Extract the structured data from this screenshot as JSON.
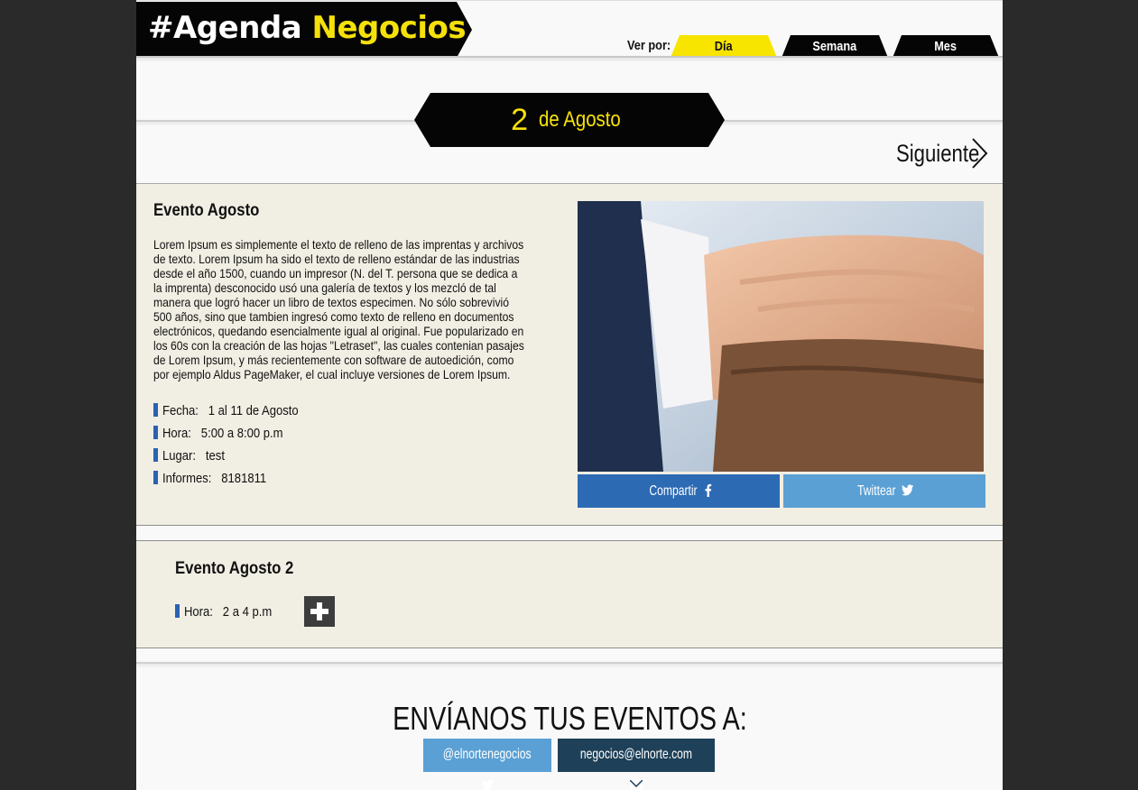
{
  "header": {
    "logo_prefix": "#Agenda ",
    "logo_highlight": "Negocios",
    "view_label": "Ver por:",
    "tabs": [
      {
        "label": "Día",
        "active": true
      },
      {
        "label": "Semana",
        "active": false
      },
      {
        "label": "Mes",
        "active": false
      }
    ]
  },
  "date": {
    "day": "2",
    "month": "de Agosto",
    "next_label": "Siguiente"
  },
  "events": [
    {
      "title": "Evento Agosto",
      "description": "Lorem Ipsum es simplemente el texto de relleno de las imprentas y archivos de texto. Lorem Ipsum ha sido el texto de relleno estándar de las industrias desde el año 1500, cuando un impresor (N. del T. persona que se dedica a la imprenta) desconocido usó una galería de textos y los mezcló de tal manera que logró hacer un libro de textos especimen. No sólo sobrevivió 500 años, sino que tambien ingresó como texto de relleno en documentos electrónicos, quedando esencialmente igual al original. Fue popularizado en los 60s con la creación de las hojas \"Letraset\", las cuales contenian pasajes de Lorem Ipsum, y más recientemente con software de autoedición, como por ejemplo Aldus PageMaker, el cual incluye versiones de Lorem Ipsum.",
      "details": [
        {
          "label": "Fecha:",
          "value": "1 al 11 de Agosto"
        },
        {
          "label": "Hora:",
          "value": "5:00 a 8:00 p.m"
        },
        {
          "label": "Lugar:",
          "value": "test"
        },
        {
          "label": "Informes:",
          "value": "8181811"
        }
      ],
      "share_facebook": "Compartir",
      "share_twitter": "Twittear"
    },
    {
      "title": "Evento Agosto 2",
      "details": [
        {
          "label": "Hora:",
          "value": "2 a 4 p.m"
        }
      ]
    }
  ],
  "footer": {
    "send_title": "ENVÍANOS TUS EVENTOS A:",
    "twitter_handle": "@elnortenegocios",
    "email": "negocios@elnorte.com"
  },
  "colors": {
    "brand_yellow": "#f5e10a",
    "facebook_blue": "#2d6ab4",
    "twitter_blue": "#5aa0d4",
    "mail_navy": "#1e4058",
    "event_bg": "#f1eee3"
  },
  "icons": [
    "chevron-right-icon",
    "facebook-icon",
    "twitter-icon",
    "envelope-icon",
    "plus-icon"
  ]
}
